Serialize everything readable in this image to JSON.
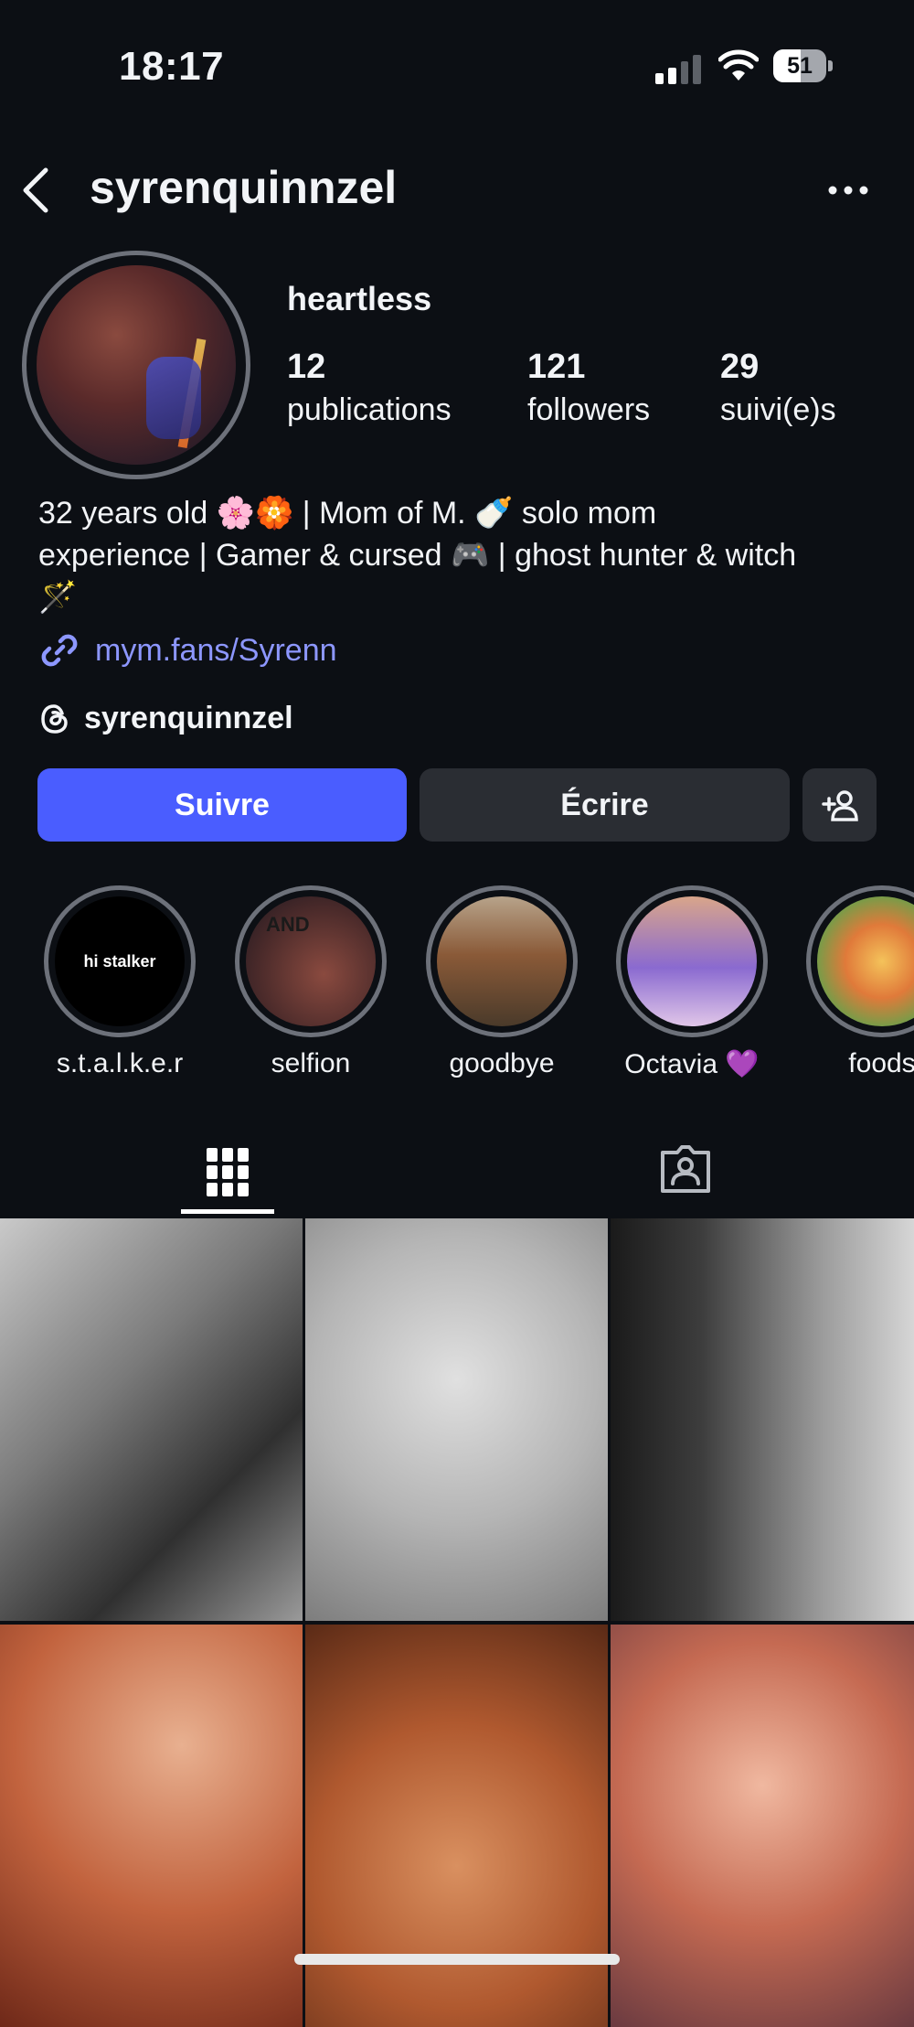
{
  "status_bar": {
    "time": "18:17",
    "battery": "51"
  },
  "header": {
    "username": "syrenquinnzel"
  },
  "profile": {
    "display_name": "heartless",
    "stats": [
      {
        "value": "12",
        "label": "publications"
      },
      {
        "value": "121",
        "label": "followers"
      },
      {
        "value": "29",
        "label": "suivi(e)s"
      }
    ],
    "bio_line1": "32 years old 🌸🏵️ | Mom of M. 🍼 solo mom",
    "bio_line2": "experience | Gamer & cursed 🎮 | ghost hunter & witch",
    "bio_line3": "🪄",
    "link": "mym.fans/Syrenn",
    "threads_handle": "syrenquinnzel"
  },
  "actions": {
    "follow": "Suivre",
    "message": "Écrire"
  },
  "highlights": [
    {
      "label": "s.t.a.l.k.e.r",
      "cover_text": "hi stalker"
    },
    {
      "label": "selfion",
      "cover_text": "AND"
    },
    {
      "label": "goodbye"
    },
    {
      "label": "Octavia 💜"
    },
    {
      "label": "foods"
    }
  ],
  "icons": {
    "back": "chevron-left-icon",
    "more": "ellipsis-icon",
    "link": "link-icon",
    "threads": "threads-icon",
    "add_user": "add-user-icon",
    "grid": "grid-icon",
    "tagged": "tagged-icon"
  },
  "colors": {
    "accent": "#4a5dff",
    "link": "#8d97ff",
    "background": "#0c0f14"
  }
}
